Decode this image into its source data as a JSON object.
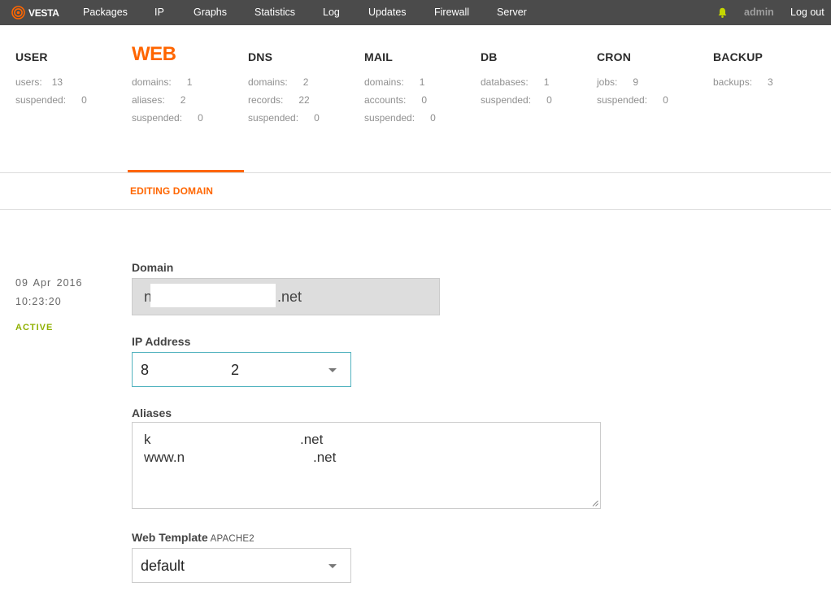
{
  "app": {
    "logo_text": "VESTA",
    "accent_color": "#ff6600",
    "active_color": "#8fb000"
  },
  "nav": {
    "items": [
      "Packages",
      "IP",
      "Graphs",
      "Statistics",
      "Log",
      "Updates",
      "Firewall",
      "Server"
    ],
    "user": "admin",
    "logout": "Log out",
    "bell_icon": "bell-icon"
  },
  "stats": [
    {
      "title": "USER",
      "rows": [
        {
          "label": "users:",
          "value": "13"
        },
        {
          "label": "suspended:",
          "value": "0"
        }
      ]
    },
    {
      "title": "WEB",
      "active": true,
      "rows": [
        {
          "label": "domains:",
          "value": "1"
        },
        {
          "label": "aliases:",
          "value": "2"
        },
        {
          "label": "suspended:",
          "value": "0"
        }
      ]
    },
    {
      "title": "DNS",
      "rows": [
        {
          "label": "domains:",
          "value": "2"
        },
        {
          "label": "records:",
          "value": "22"
        },
        {
          "label": "suspended:",
          "value": "0"
        }
      ]
    },
    {
      "title": "MAIL",
      "rows": [
        {
          "label": "domains:",
          "value": "1"
        },
        {
          "label": "accounts:",
          "value": "0"
        },
        {
          "label": "suspended:",
          "value": "0"
        }
      ]
    },
    {
      "title": "DB",
      "rows": [
        {
          "label": "databases:",
          "value": "1"
        },
        {
          "label": "suspended:",
          "value": "0"
        }
      ]
    },
    {
      "title": "CRON",
      "rows": [
        {
          "label": "jobs:",
          "value": "9"
        },
        {
          "label": "suspended:",
          "value": "0"
        }
      ]
    },
    {
      "title": "BACKUP",
      "rows": [
        {
          "label": "backups:",
          "value": "3"
        }
      ]
    }
  ],
  "page": {
    "subtitle": "EDITING DOMAIN"
  },
  "meta": {
    "date": "09 Apr 2016",
    "time": "10:23:20",
    "status": "ACTIVE"
  },
  "form": {
    "domain": {
      "label": "Domain",
      "value_start": "n",
      "value_end": ".net"
    },
    "ip": {
      "label": "IP Address",
      "value_start": "8",
      "value_end": "2"
    },
    "aliases": {
      "label": "Aliases",
      "line1_start": "k",
      "line1_end": ".net",
      "line2_start": "www.n",
      "line2_end": ".net"
    },
    "web_template": {
      "label": "Web Template",
      "hint": "APACHE2",
      "value": "default"
    }
  }
}
